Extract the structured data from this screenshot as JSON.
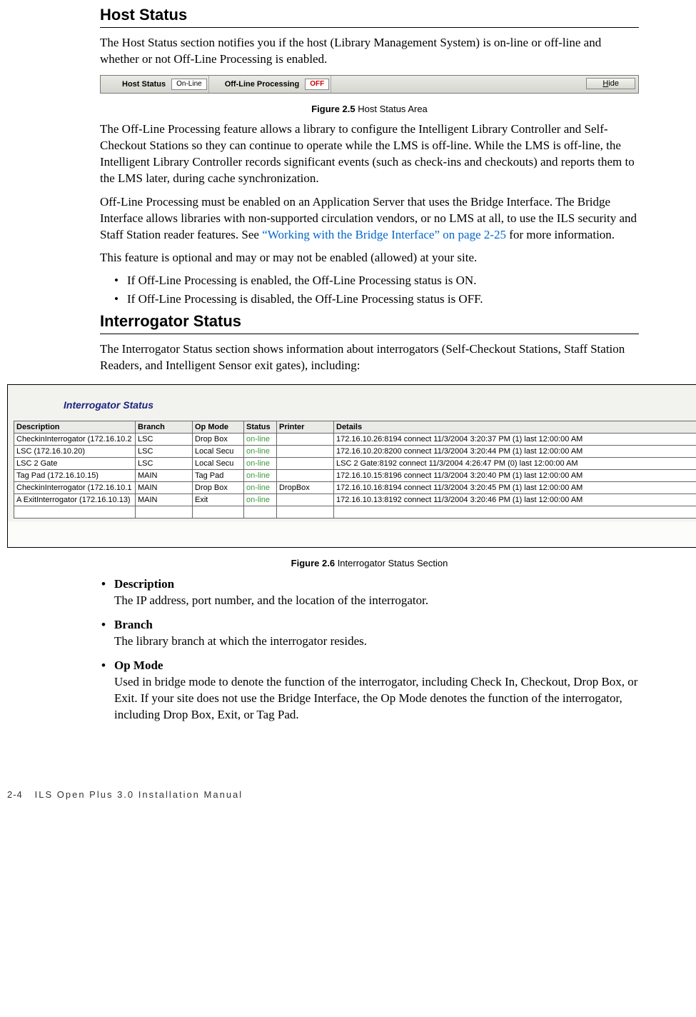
{
  "section1": {
    "heading": "Host Status",
    "para1": "The Host Status section notifies you if the host (Library Management System) is on-line or off-line and whether or not Off-Line Processing is enabled.",
    "fig_label": "Figure 2.5",
    "fig_caption": " Host Status Area",
    "status_bar": {
      "host_label": "Host Status",
      "host_value": "On-Line",
      "offline_label": "Off-Line Processing",
      "offline_value": "OFF",
      "hide_letter": "H",
      "hide_rest": "ide"
    },
    "para2": "The Off-Line Processing feature allows a library to configure the Intelligent Library Controller and Self-Checkout Stations so they can continue to operate while the LMS is off-line. While the LMS is off-line, the Intelligent Library Controller records significant events (such as check-ins and checkouts) and reports them to the LMS later, during cache synchronization.",
    "para3a": "Off-Line Processing must be enabled on an Application Server that uses the Bridge Interface. The Bridge Interface allows libraries with non-supported circulation vendors, or no LMS at all, to use the ILS security and Staff Station reader features. See ",
    "para3_link": "“Working with the Bridge Interface” on page 2-25",
    "para3b": " for more information.",
    "para4": "This feature is optional and may or may not be enabled (allowed) at your site.",
    "bullet1": "If Off-Line Processing is enabled, the Off-Line Processing status is ON.",
    "bullet2": "If Off-Line Processing is disabled, the Off-Line Processing status is OFF."
  },
  "section2": {
    "heading": "Interrogator Status",
    "para1": "The Interrogator Status section shows information about interrogators (Self-Checkout Stations, Staff Station Readers, and Intelligent Sensor exit gates), including:",
    "fig_title": "Interrogator Status",
    "table": {
      "headers": {
        "description": "Description",
        "branch": "Branch",
        "op_mode": "Op Mode",
        "status": "Status",
        "printer": "Printer",
        "details": "Details"
      },
      "rows": [
        {
          "description": "CheckinInterrogator (172.16.10.2",
          "branch": "LSC",
          "op_mode": "Drop Box",
          "status": "on-line",
          "printer": "",
          "details": "172.16.10.26:8194 connect 11/3/2004 3:20:37 PM (1) last 12:00:00 AM"
        },
        {
          "description": "LSC (172.16.10.20)",
          "branch": "LSC",
          "op_mode": "Local Secu",
          "status": "on-line",
          "printer": "",
          "details": "172.16.10.20:8200 connect 11/3/2004 3:20:44 PM (1) last 12:00:00 AM"
        },
        {
          "description": "LSC 2 Gate",
          "branch": "LSC",
          "op_mode": "Local Secu",
          "status": "on-line",
          "printer": "",
          "details": "LSC 2 Gate:8192 connect 11/3/2004 4:26:47 PM (0) last 12:00:00 AM"
        },
        {
          "description": "Tag Pad (172.16.10.15)",
          "branch": "MAIN",
          "op_mode": "Tag Pad",
          "status": "on-line",
          "printer": "",
          "details": "172.16.10.15:8196 connect 11/3/2004 3:20:40 PM (1) last 12:00:00 AM"
        },
        {
          "description": "CheckinInterrogator (172.16.10.1",
          "branch": "MAIN",
          "op_mode": "Drop Box",
          "status": "on-line",
          "printer": "DropBox",
          "details": "172.16.10.16:8194 connect 11/3/2004 3:20:45 PM (1) last 12:00:00 AM"
        },
        {
          "description": "A ExitInterrogator (172.16.10.13)",
          "branch": "MAIN",
          "op_mode": "Exit",
          "status": "on-line",
          "printer": "",
          "details": "172.16.10.13:8192 connect 11/3/2004 3:20:46 PM (1) last 12:00:00 AM"
        }
      ]
    },
    "fig_label": "Figure 2.6",
    "fig_caption": " Interrogator Status Section",
    "defs": [
      {
        "term": "Description",
        "desc": "The IP address, port number, and the location of the interrogator."
      },
      {
        "term": "Branch",
        "desc": "The library branch at which the interrogator resides."
      },
      {
        "term": "Op Mode",
        "desc": "Used in bridge mode to denote the function of the interrogator, including Check In, Checkout, Drop Box, or Exit. If your site does not use the Bridge Interface, the Op Mode denotes the function of the interrogator, including Drop Box, Exit, or Tag Pad."
      }
    ]
  },
  "footer": {
    "pagenum": "2-4",
    "book": "ILS Open Plus 3.0 Installation Manual"
  }
}
